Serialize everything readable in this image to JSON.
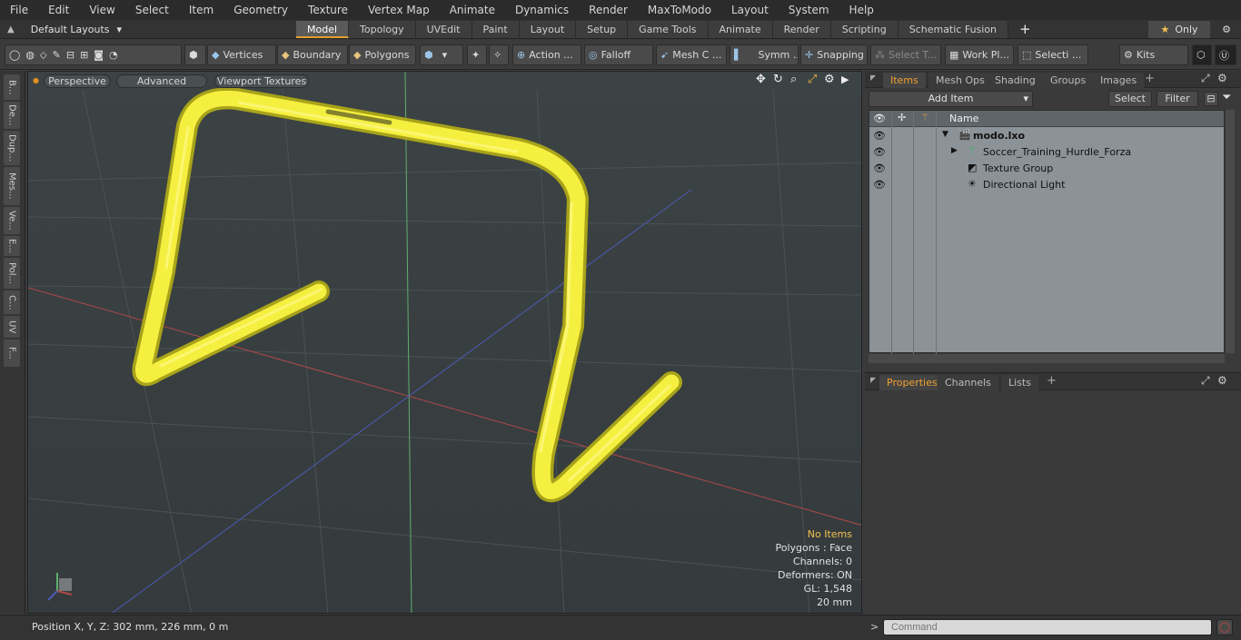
{
  "menu": [
    "File",
    "Edit",
    "View",
    "Select",
    "Item",
    "Geometry",
    "Texture",
    "Vertex Map",
    "Animate",
    "Dynamics",
    "Render",
    "MaxToModo",
    "Layout",
    "System",
    "Help"
  ],
  "layout": {
    "name": "Default Layouts",
    "caret": "▾"
  },
  "tabs": [
    "Model",
    "Topology",
    "UVEdit",
    "Paint",
    "Layout",
    "Setup",
    "Game Tools",
    "Animate",
    "Render",
    "Scripting",
    "Schematic Fusion"
  ],
  "active_tab": "Model",
  "add_tab_symbol": "+",
  "only_label": "Only",
  "toolbar": {
    "vertices": "Vertices",
    "boundary": "Boundary",
    "polygons": "Polygons",
    "action": "Action ...",
    "falloff": "Falloff",
    "mesh": "Mesh C ...",
    "symm": "Symm ...",
    "snapping": "Snapping",
    "select_t": "Select T...",
    "work_pl": "Work Pl...",
    "selecti": "Selecti ...",
    "kits": "Kits"
  },
  "left_tabs": [
    "B...",
    "De...",
    "Dup...",
    "Mes...",
    "Ve...",
    "E...",
    "Pol...",
    "C...",
    "UV",
    "F..."
  ],
  "viewport": {
    "perspective": "Perspective",
    "advanced": "Advanced",
    "viewport_textures": "Viewport Textures",
    "stats": {
      "no_items": "No Items",
      "polygons": "Polygons : Face",
      "channels": "Channels: 0",
      "deformers": "Deformers: ON",
      "gl": "GL: 1,548",
      "scale": "20 mm"
    }
  },
  "status": {
    "position": "Position X, Y, Z:   302 mm, 226 mm, 0 m"
  },
  "items_panel": {
    "tabs": [
      "Items",
      "Mesh Ops",
      "Shading",
      "Groups",
      "Images"
    ],
    "active": "Items",
    "add_item": "Add Item",
    "select": "Select",
    "filter": "Filter",
    "column_name": "Name",
    "rows": [
      {
        "label": "modo.lxo"
      },
      {
        "label": "Soccer_Training_Hurdle_Forza"
      },
      {
        "label": "Texture Group"
      },
      {
        "label": "Directional Light"
      }
    ]
  },
  "props_panel": {
    "tabs": [
      "Properties",
      "Channels",
      "Lists"
    ],
    "active": "Properties"
  },
  "command": {
    "prompt": ">",
    "placeholder": "Command"
  },
  "colors": {
    "accent": "#e0a12c",
    "hurdle": "#f5f040",
    "tab_active_text": "#f0a030"
  }
}
